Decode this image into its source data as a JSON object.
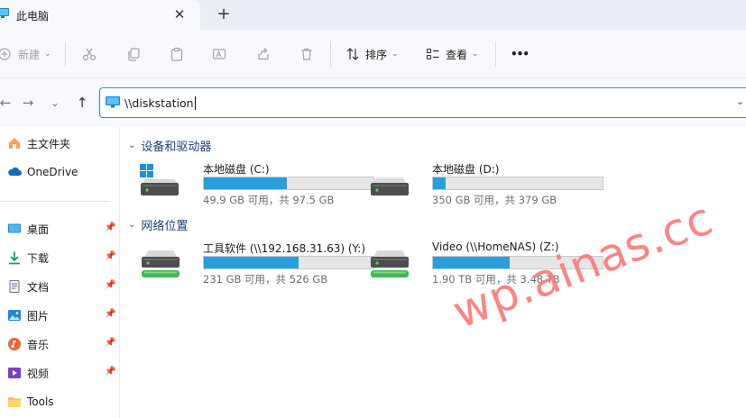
{
  "tab": {
    "title": "此电脑",
    "close": "✕",
    "new_tab": "+"
  },
  "toolbar": {
    "new_label": "新建",
    "sort_label": "排序",
    "view_label": "查看",
    "more_label": "•••",
    "caret": "⌄"
  },
  "nav": {
    "back": "←",
    "forward": "→",
    "recent": "⌄",
    "up": "↑"
  },
  "address": {
    "value": "\\\\diskstation",
    "dropdown": "⌄"
  },
  "sidebar": {
    "pinned": [
      {
        "label": "主文件夹",
        "icon": "home-icon"
      },
      {
        "label": "OneDrive",
        "icon": "cloud-icon"
      }
    ],
    "quick": [
      {
        "label": "桌面",
        "icon": "desktop-icon",
        "pinned": true
      },
      {
        "label": "下载",
        "icon": "download-icon",
        "pinned": true
      },
      {
        "label": "文档",
        "icon": "document-icon",
        "pinned": true
      },
      {
        "label": "图片",
        "icon": "pictures-icon",
        "pinned": true
      },
      {
        "label": "音乐",
        "icon": "music-icon",
        "pinned": true
      },
      {
        "label": "视频",
        "icon": "video-icon",
        "pinned": true
      },
      {
        "label": "Tools",
        "icon": "folder-icon",
        "pinned": false
      }
    ]
  },
  "groups": {
    "devices": {
      "title": "设备和驱动器",
      "chevron": "⌄",
      "items": [
        {
          "name": "本地磁盘 (C:)",
          "free": "49.9 GB 可用，共 97.5 GB",
          "used_fraction": 0.488
        },
        {
          "name": "本地磁盘 (D:)",
          "free": "350 GB 可用，共 379 GB",
          "used_fraction": 0.077
        }
      ]
    },
    "network": {
      "title": "网络位置",
      "chevron": "⌄",
      "items": [
        {
          "name": "工具软件 (\\\\192.168.31.63) (Y:)",
          "free": "231 GB 可用，共 526 GB",
          "used_fraction": 0.561
        },
        {
          "name": "Video (\\\\HomeNAS) (Z:)",
          "free": "1.90 TB 可用，共 3.48 TB",
          "used_fraction": 0.454
        }
      ]
    }
  },
  "watermark": "wp.ainas.cc",
  "colors": {
    "accent": "#26a0da",
    "group_header": "#1c3f7a",
    "focus_border": "#2f8ad8",
    "watermark": "#fa7878"
  }
}
